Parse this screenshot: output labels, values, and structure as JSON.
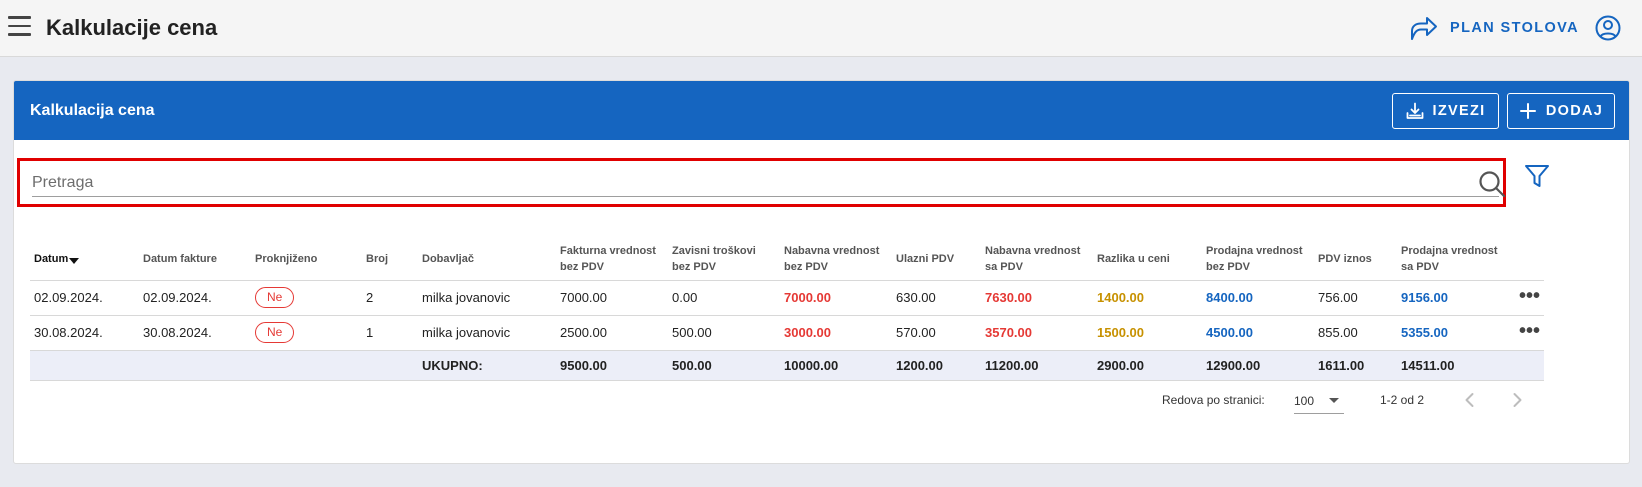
{
  "app": {
    "title": "Kalkulacije cena",
    "plan_label": "PLAN STOLOVA"
  },
  "card": {
    "title": "Kalkulacija cena",
    "export_label": "IZVEZI",
    "add_label": "DODAJ"
  },
  "search": {
    "placeholder": "Pretraga"
  },
  "colors": {
    "primary": "#1565c0",
    "red_value": "#e53935",
    "gold_value": "#c79100",
    "highlight": "#e00000"
  },
  "table": {
    "headers": {
      "datum": "Datum",
      "datum_fakture": "Datum fakture",
      "proknjizeno": "Proknjiženo",
      "broj": "Broj",
      "dobavljac": "Dobavljač",
      "fakturna": "Fakturna vrednost bez PDV",
      "zavisni": "Zavisni troškovi bez PDV",
      "nabavna": "Nabavna vrednost bez PDV",
      "ulazni": "Ulazni PDV",
      "nabavna_sa": "Nabavna vrednost sa PDV",
      "razlika": "Razlika u ceni",
      "prodajna": "Prodajna vrednost bez PDV",
      "pdv_iznos": "PDV iznos",
      "prodajna_sa": "Prodajna vrednost sa PDV"
    },
    "rows": [
      {
        "datum": "02.09.2024.",
        "datum_fakture": "02.09.2024.",
        "proknjizeno": "Ne",
        "broj": "2",
        "dobavljac": "milka jovanovic",
        "fakturna": "7000.00",
        "zavisni": "0.00",
        "nabavna": "7000.00",
        "ulazni": "630.00",
        "nabavna_sa": "7630.00",
        "razlika": "1400.00",
        "prodajna": "8400.00",
        "pdv_iznos": "756.00",
        "prodajna_sa": "9156.00"
      },
      {
        "datum": "30.08.2024.",
        "datum_fakture": "30.08.2024.",
        "proknjizeno": "Ne",
        "broj": "1",
        "dobavljac": "milka jovanovic",
        "fakturna": "2500.00",
        "zavisni": "500.00",
        "nabavna": "3000.00",
        "ulazni": "570.00",
        "nabavna_sa": "3570.00",
        "razlika": "1500.00",
        "prodajna": "4500.00",
        "pdv_iznos": "855.00",
        "prodajna_sa": "5355.00"
      }
    ],
    "totals": {
      "label": "UKUPNO:",
      "fakturna": "9500.00",
      "zavisni": "500.00",
      "nabavna": "10000.00",
      "ulazni": "1200.00",
      "nabavna_sa": "11200.00",
      "razlika": "2900.00",
      "prodajna": "12900.00",
      "pdv_iznos": "1611.00",
      "prodajna_sa": "14511.00"
    }
  },
  "pagination": {
    "rows_label": "Redova po stranici:",
    "rows_value": "100",
    "range": "1-2 od 2"
  },
  "icons": [
    "menu-icon",
    "share-arrow-icon",
    "account-circle-icon",
    "download-icon",
    "plus-icon",
    "search-icon",
    "filter-icon",
    "more-horizontal-icon",
    "chevron-left-icon",
    "chevron-right-icon"
  ]
}
